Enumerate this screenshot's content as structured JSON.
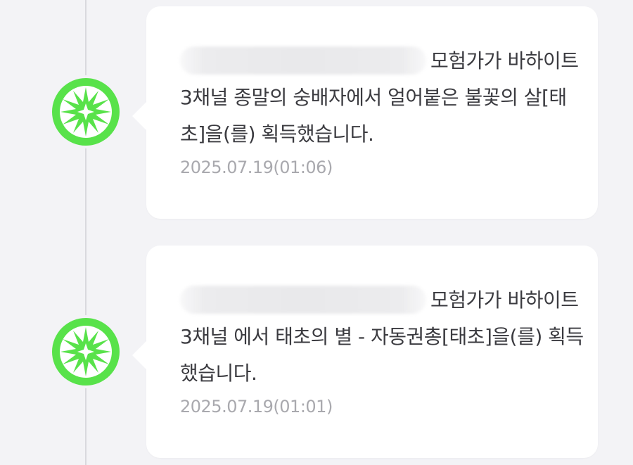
{
  "notifications": [
    {
      "redacted_name": "",
      "message": "모험가가 바하이트 3채널 종말의 숭배자에서 얼어붙은 불꽃의 살[태초]을(를) 획득했습니다.",
      "timestamp": "2025.07.19(01:06)",
      "icon": "green-burst-icon"
    },
    {
      "redacted_name": "",
      "message": "모험가가 바하이트 3채널 에서 태초의 별 - 자동권총[태초]을(를) 획득했습니다.",
      "timestamp": "2025.07.19(01:01)",
      "icon": "green-burst-icon"
    }
  ],
  "colors": {
    "marker": "#58e24a",
    "background": "#f3f3f6",
    "card": "#ffffff",
    "text": "#3b3b40",
    "timestamp": "#a9a9ae"
  }
}
